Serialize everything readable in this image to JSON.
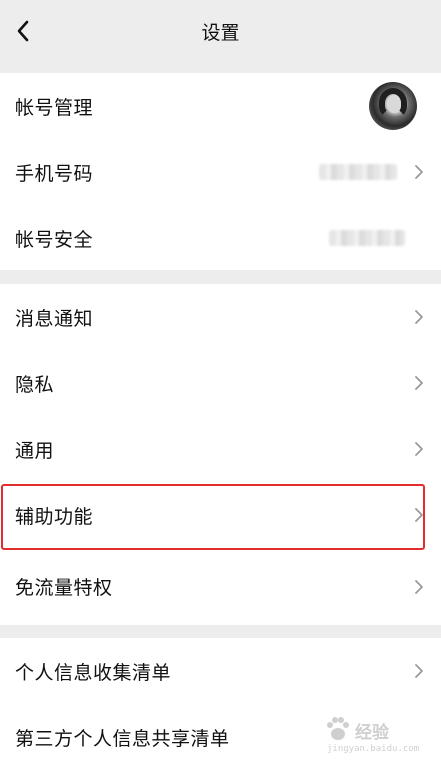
{
  "header": {
    "title": "设置"
  },
  "account_group": {
    "account_management": "帐号管理",
    "phone_number": "手机号码",
    "account_security": "帐号安全"
  },
  "settings_group": {
    "notifications": "消息通知",
    "privacy": "隐私",
    "general": "通用",
    "accessibility": "辅助功能",
    "data_saver": "免流量特权"
  },
  "info_group": {
    "personal_info_list": "个人信息收集清单",
    "third_party_list": "第三方个人信息共享清单"
  },
  "watermark": {
    "text": "经验",
    "sub": "jingyan.baidu.com"
  },
  "colors": {
    "highlight": "#e22d2d",
    "background": "#ededed",
    "row_background": "#ffffff"
  }
}
